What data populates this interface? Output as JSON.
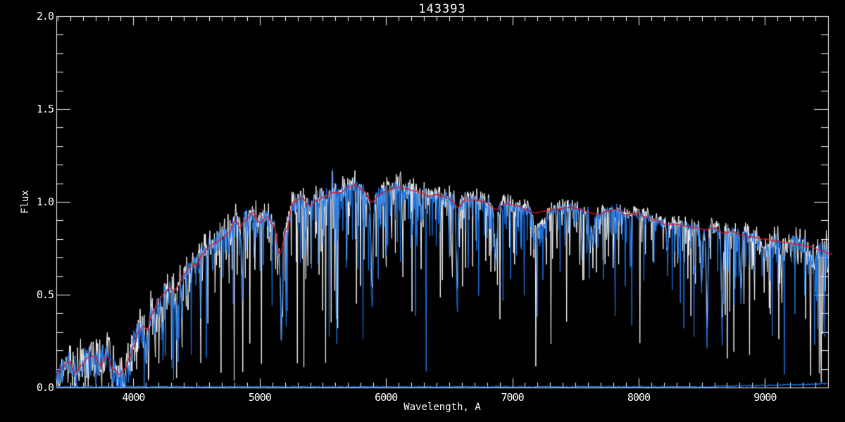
{
  "title": "143393",
  "axes": {
    "xlabel": "Wavelength, A",
    "ylabel": "Flux",
    "x_tick_values": [
      4000,
      5000,
      6000,
      7000,
      8000,
      9000
    ],
    "x_tick_labels": [
      "4000",
      "5000",
      "6000",
      "7000",
      "8000",
      "9000"
    ],
    "y_tick_values": [
      0.0,
      0.5,
      1.0,
      1.5,
      2.0
    ],
    "y_tick_labels": [
      "0.0",
      "0.5",
      "1.0",
      "1.5",
      "2.0"
    ]
  },
  "colors": {
    "background": "#000000",
    "frame": "#ffffff",
    "raw_spectrum": "#ffffff",
    "observed_spectrum": "#1e7af0",
    "model": "#e01525"
  },
  "chart_data": {
    "type": "line",
    "title": "143393",
    "xlabel": "Wavelength, A",
    "ylabel": "Flux",
    "xlim": [
      3390,
      9500
    ],
    "ylim": [
      0,
      2
    ],
    "x_major": 1000,
    "x_minor": 100,
    "y_major": 0.5,
    "y_minor": 0.1,
    "grid": false,
    "legend": "none",
    "series": [
      {
        "name": "raw-spectrum",
        "color": "#ffffff",
        "style": "noisy"
      },
      {
        "name": "observed-spectrum",
        "color": "#1e7af0",
        "style": "noisy"
      },
      {
        "name": "model-fit",
        "color": "#e01525",
        "style": "smooth"
      },
      {
        "name": "zero-level-line",
        "color": "#1e7af0",
        "style": "flat-noisy"
      }
    ],
    "continuum": [
      [
        3390,
        0.07
      ],
      [
        3440,
        0.11
      ],
      [
        3490,
        0.14
      ],
      [
        3540,
        0.08
      ],
      [
        3590,
        0.12
      ],
      [
        3640,
        0.16
      ],
      [
        3690,
        0.17
      ],
      [
        3740,
        0.12
      ],
      [
        3790,
        0.17
      ],
      [
        3840,
        0.1
      ],
      [
        3890,
        0.07
      ],
      [
        3930,
        0.1
      ],
      [
        3970,
        0.16
      ],
      [
        4000,
        0.22
      ],
      [
        4040,
        0.3
      ],
      [
        4080,
        0.33
      ],
      [
        4110,
        0.31
      ],
      [
        4150,
        0.4
      ],
      [
        4200,
        0.47
      ],
      [
        4250,
        0.51
      ],
      [
        4290,
        0.54
      ],
      [
        4320,
        0.52
      ],
      [
        4360,
        0.55
      ],
      [
        4400,
        0.61
      ],
      [
        4450,
        0.65
      ],
      [
        4500,
        0.66
      ],
      [
        4550,
        0.72
      ],
      [
        4600,
        0.76
      ],
      [
        4650,
        0.78
      ],
      [
        4700,
        0.8
      ],
      [
        4750,
        0.83
      ],
      [
        4810,
        0.9
      ],
      [
        4845,
        0.86
      ],
      [
        4880,
        0.9
      ],
      [
        4950,
        0.94
      ],
      [
        5000,
        0.89
      ],
      [
        5060,
        0.92
      ],
      [
        5110,
        0.87
      ],
      [
        5160,
        0.72
      ],
      [
        5210,
        0.85
      ],
      [
        5270,
        1.0
      ],
      [
        5330,
        1.02
      ],
      [
        5400,
        0.98
      ],
      [
        5460,
        1.01
      ],
      [
        5520,
        1.03
      ],
      [
        5580,
        1.05
      ],
      [
        5640,
        1.05
      ],
      [
        5700,
        1.08
      ],
      [
        5760,
        1.09
      ],
      [
        5820,
        1.06
      ],
      [
        5890,
        1.0
      ],
      [
        5950,
        1.04
      ],
      [
        6010,
        1.06
      ],
      [
        6100,
        1.08
      ],
      [
        6160,
        1.07
      ],
      [
        6220,
        1.06
      ],
      [
        6280,
        1.05
      ],
      [
        6340,
        1.03
      ],
      [
        6400,
        1.04
      ],
      [
        6460,
        1.03
      ],
      [
        6520,
        1.01
      ],
      [
        6570,
        0.97
      ],
      [
        6630,
        1.01
      ],
      [
        6700,
        1.01
      ],
      [
        6780,
        1.0
      ],
      [
        6870,
        0.96
      ],
      [
        6950,
        0.99
      ],
      [
        7030,
        0.98
      ],
      [
        7110,
        0.96
      ],
      [
        7180,
        0.94
      ],
      [
        7260,
        0.95
      ],
      [
        7350,
        0.96
      ],
      [
        7450,
        0.97
      ],
      [
        7550,
        0.96
      ],
      [
        7620,
        0.94
      ],
      [
        7680,
        0.93
      ],
      [
        7750,
        0.95
      ],
      [
        7830,
        0.96
      ],
      [
        7900,
        0.93
      ],
      [
        7980,
        0.94
      ],
      [
        8050,
        0.92
      ],
      [
        8130,
        0.9
      ],
      [
        8210,
        0.88
      ],
      [
        8290,
        0.88
      ],
      [
        8370,
        0.87
      ],
      [
        8450,
        0.86
      ],
      [
        8530,
        0.85
      ],
      [
        8600,
        0.86
      ],
      [
        8670,
        0.83
      ],
      [
        8740,
        0.84
      ],
      [
        8820,
        0.82
      ],
      [
        8900,
        0.81
      ],
      [
        8990,
        0.8
      ],
      [
        9080,
        0.79
      ],
      [
        9170,
        0.78
      ],
      [
        9260,
        0.77
      ],
      [
        9350,
        0.76
      ],
      [
        9440,
        0.74
      ],
      [
        9520,
        0.72
      ]
    ],
    "absorption_lines": [
      [
        3835,
        6,
        0.45
      ],
      [
        3890,
        6,
        0.5
      ],
      [
        3933,
        7,
        0.7
      ],
      [
        3968,
        7,
        0.6
      ],
      [
        4101,
        6,
        0.45
      ],
      [
        4172,
        5,
        0.3
      ],
      [
        4226,
        5,
        0.35
      ],
      [
        4340,
        6,
        0.4
      ],
      [
        4383,
        5,
        0.35
      ],
      [
        4861,
        6,
        0.45
      ],
      [
        5172,
        7,
        0.65
      ],
      [
        5890,
        8,
        0.55
      ],
      [
        6277,
        6,
        0.12
      ],
      [
        6563,
        6,
        0.55
      ],
      [
        6867,
        10,
        0.3
      ],
      [
        7186,
        18,
        0.15
      ],
      [
        7250,
        25,
        0.08
      ],
      [
        7605,
        12,
        0.22
      ],
      [
        7640,
        8,
        0.2
      ],
      [
        8227,
        6,
        0.2
      ],
      [
        8498,
        6,
        0.4
      ],
      [
        8542,
        7,
        0.72
      ],
      [
        8662,
        7,
        0.68
      ],
      [
        8811,
        6,
        0.42
      ],
      [
        9000,
        30,
        0.1
      ],
      [
        9150,
        20,
        0.1
      ],
      [
        9380,
        30,
        0.1
      ]
    ],
    "emission_spikes": [
      [
        5577,
        0.17,
        2.5
      ],
      [
        6300,
        0.06,
        2.0
      ],
      [
        7600,
        0.28,
        2.8
      ]
    ],
    "noise_amp_profile": [
      [
        3390,
        0.1
      ],
      [
        3800,
        0.1
      ],
      [
        4200,
        0.085
      ],
      [
        4600,
        0.07
      ],
      [
        5000,
        0.06
      ],
      [
        5600,
        0.055
      ],
      [
        6200,
        0.05
      ],
      [
        6800,
        0.04
      ],
      [
        7400,
        0.032
      ],
      [
        8000,
        0.028
      ],
      [
        8400,
        0.032
      ],
      [
        8800,
        0.045
      ],
      [
        9100,
        0.055
      ],
      [
        9500,
        0.085
      ]
    ],
    "spike_scale_profile": [
      [
        3390,
        1.1
      ],
      [
        4000,
        1.0
      ],
      [
        4400,
        0.85
      ],
      [
        5000,
        0.7
      ],
      [
        5600,
        0.65
      ],
      [
        6200,
        0.6
      ],
      [
        6800,
        0.55
      ],
      [
        7400,
        0.5
      ],
      [
        8000,
        0.45
      ],
      [
        8600,
        0.6
      ],
      [
        9000,
        0.65
      ],
      [
        9500,
        0.7
      ]
    ],
    "zero_line_profile": [
      [
        3390,
        0.004
      ],
      [
        8500,
        0.004
      ],
      [
        8800,
        0.009
      ],
      [
        9000,
        0.011
      ],
      [
        9200,
        0.015
      ],
      [
        9350,
        0.018
      ],
      [
        9500,
        0.02
      ]
    ],
    "sample_step": 4,
    "blue": {
      "seed": 42,
      "spike_prob": 0.3,
      "spike_depth": 0.3,
      "amp_mult": 1.0,
      "offset": 0.0,
      "line_depth_mult": 1.0
    },
    "white": {
      "seed": 77,
      "spike_prob": 0.33,
      "spike_depth": 0.345,
      "amp_mult": 1.55,
      "offset": 0.012,
      "line_depth_mult": 0.85
    },
    "zero": {
      "seed": 7,
      "jitter": 0.006
    }
  }
}
